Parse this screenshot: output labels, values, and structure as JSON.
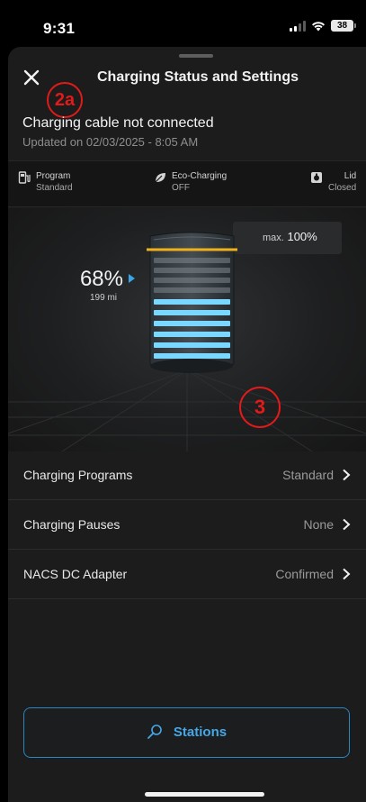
{
  "status_bar": {
    "time": "9:31",
    "battery": "38"
  },
  "header": {
    "title": "Charging Status and Settings"
  },
  "annotations": {
    "a1": "2a",
    "a2": "3"
  },
  "status": {
    "main": "Charging cable not connected",
    "updated": "Updated on 02/03/2025 - 8:05 AM"
  },
  "info": {
    "program": {
      "label": "Program",
      "value": "Standard"
    },
    "eco": {
      "label": "Eco-Charging",
      "value": "OFF"
    },
    "lid": {
      "label": "Lid",
      "value": "Closed"
    }
  },
  "charge": {
    "percent": "68%",
    "percent_value": 68,
    "range": "199 mi",
    "max_label": "max.",
    "max_value": "100%"
  },
  "settings": [
    {
      "label": "Charging Programs",
      "value": "Standard"
    },
    {
      "label": "Charging Pauses",
      "value": "None"
    },
    {
      "label": "NACS DC Adapter",
      "value": "Confirmed"
    }
  ],
  "stations": {
    "label": "Stations"
  },
  "colors": {
    "accent": "#47a7e6",
    "max_line": "#f0b21a",
    "annotation": "#e11a1a"
  }
}
